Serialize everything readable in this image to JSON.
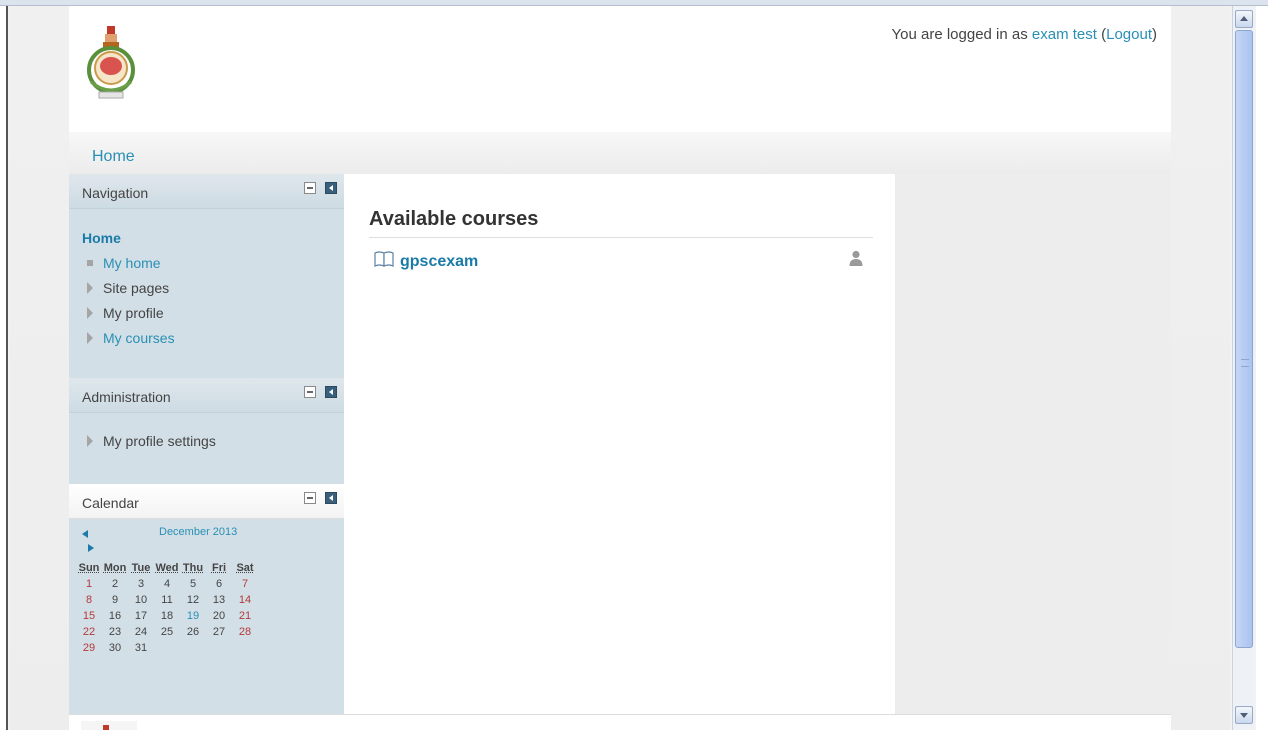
{
  "header": {
    "login_prefix": "You are logged in as ",
    "user_name": "exam test",
    "logout_open": " (",
    "logout_label": "Logout",
    "logout_close": ")"
  },
  "breadcrumb": {
    "home": "Home"
  },
  "navigation": {
    "title": "Navigation",
    "home": "Home",
    "items": [
      {
        "label": "My home",
        "link": true
      },
      {
        "label": "Site pages",
        "link": false
      },
      {
        "label": "My profile",
        "link": false
      },
      {
        "label": "My courses",
        "link": true
      }
    ]
  },
  "administration": {
    "title": "Administration",
    "items": [
      {
        "label": "My profile settings"
      }
    ]
  },
  "calendar": {
    "title": "Calendar",
    "month": "December 2013",
    "weekdays": [
      "Sun",
      "Mon",
      "Tue",
      "Wed",
      "Thu",
      "Fri",
      "Sat"
    ],
    "weeks": [
      [
        "1",
        "2",
        "3",
        "4",
        "5",
        "6",
        "7"
      ],
      [
        "8",
        "9",
        "10",
        "11",
        "12",
        "13",
        "14"
      ],
      [
        "15",
        "16",
        "17",
        "18",
        "19",
        "20",
        "21"
      ],
      [
        "22",
        "23",
        "24",
        "25",
        "26",
        "27",
        "28"
      ],
      [
        "29",
        "30",
        "31",
        "",
        "",
        "",
        ""
      ]
    ],
    "today": "19"
  },
  "main": {
    "heading": "Available courses",
    "courses": [
      {
        "name": "gpscexam"
      }
    ]
  },
  "colors": {
    "link": "#2a8fb5",
    "weekend": "#b33a3a",
    "block_bg": "#d3dfe6"
  }
}
